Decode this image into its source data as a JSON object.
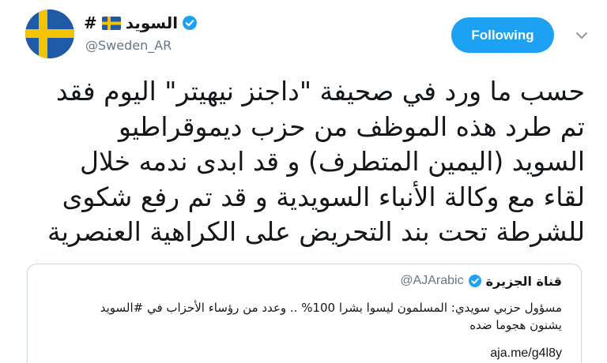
{
  "header": {
    "display_name": "السويد",
    "hash": "#",
    "handle": "@Sweden_AR",
    "follow_label": "Following"
  },
  "tweet": {
    "lines": [
      "حسب ما ورد في صحيفة \"داجنز نيهيتر\" اليوم فقد",
      "تم طرد هذه الموظف من حزب ديموقراطيو",
      "السويد (اليمين المتطرف) و قد ابدى ندمه خلال",
      "لقاء مع وكالة الأنباء السويدية و قد تم رفع شكوى",
      "للشرطة تحت بند التحريض على الكراهية العنصرية"
    ]
  },
  "quote": {
    "name": "قناة الجزيرة",
    "handle": "@AJArabic",
    "lines": [
      "مسؤول حزبي سويدي: المسلمون ليسوا بشرا 100% .. وعدد من رؤساء الأحزاب في #السويد",
      "يشنون هجوما ضده"
    ],
    "link": "aja.me/g4l8y"
  },
  "colors": {
    "accent": "#1da1f2",
    "secondary_text": "#657786",
    "flag_blue": "#1f5aa6",
    "flag_yellow": "#f5c400"
  }
}
